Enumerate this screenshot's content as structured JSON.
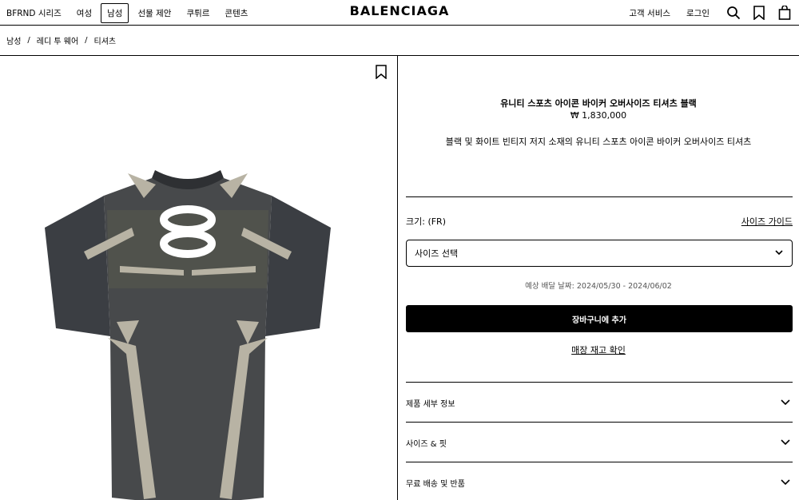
{
  "header": {
    "nav": [
      "BFRND 시리즈",
      "여성",
      "남성",
      "선물 제안",
      "쿠튀르",
      "콘텐츠"
    ],
    "active_nav": "남성",
    "logo": "BALENCIAGA",
    "customer_service": "고객 서비스",
    "login": "로그인",
    "icons": [
      "search-icon",
      "bookmark-icon",
      "shopping-bag-icon"
    ]
  },
  "breadcrumb": [
    "남성",
    "레디 투 웨어",
    "티셔츠"
  ],
  "product": {
    "name": "유니티 스포츠 아이콘 바이커 오버사이즈 티셔츠 블랙",
    "price": "₩ 1,830,000",
    "description": "블랙 및 화이트 빈티지 저지 소재의 유니티 스포츠 아이콘 바이커 오버사이즈 티셔츠",
    "image_colors": {
      "body": "#45484c",
      "stripe": "#b8b3a4",
      "logo": "#ffffff"
    }
  },
  "purchase": {
    "size_label": "크기: (FR)",
    "size_guide": "사이즈 가이드",
    "size_select": "사이즈 선택",
    "delivery": "예상 배달 날짜: 2024/05/30 - 2024/06/02",
    "add_to_cart": "장바구니에 추가",
    "stock_check": "매장 재고 확인"
  },
  "accordion": [
    "제품 세부 정보",
    "사이즈 & 핏",
    "무료 배송 및 반품"
  ]
}
